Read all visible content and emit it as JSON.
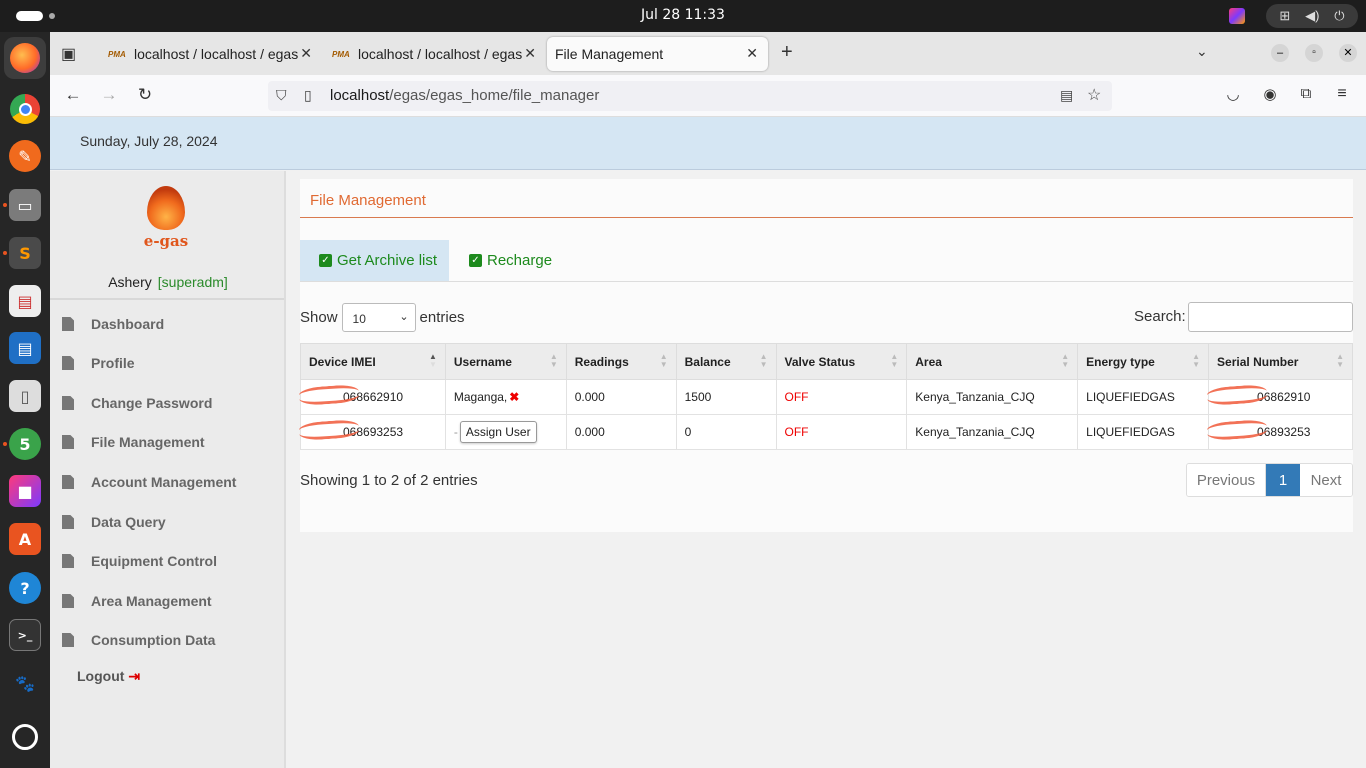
{
  "system": {
    "clock": "Jul 28  11:33",
    "tray": [
      "network-icon",
      "volume-icon",
      "power-icon"
    ]
  },
  "dock": [
    "firefox-icon",
    "chrome-icon",
    "inkscape-icon",
    "files-icon",
    "sublime-icon",
    "document-viewer-icon",
    "libreoffice-writer-icon",
    "text-editor-icon",
    "calculator-icon",
    "jetbrains-icon",
    "app-center-icon",
    "help-icon",
    "terminal-icon",
    "gimp-icon",
    "ubuntu-icon"
  ],
  "browser": {
    "tabs": [
      {
        "label": "localhost / localhost / egas"
      },
      {
        "label": "localhost / localhost / egas"
      },
      {
        "label": "File Management"
      }
    ],
    "url_host": "localhost",
    "url_path": "/egas/egas_home/file_manager"
  },
  "page": {
    "date": "Sunday, July 28, 2024",
    "brand": "e-gas",
    "user_name": "Ashery",
    "user_role": "[superadm]",
    "menu": [
      "Dashboard",
      "Profile",
      "Change Password",
      "File Management",
      "Account Management",
      "Data Query",
      "Equipment Control",
      "Area Management",
      "Consumption Data"
    ],
    "logout": "Logout",
    "title": "File Management",
    "tabs": [
      {
        "label": "Get Archive list"
      },
      {
        "label": "Recharge"
      }
    ],
    "show_label": "Show",
    "entries_value": "10",
    "entries_label": "entries",
    "search_label": "Search:",
    "table": {
      "headers": [
        "Device IMEI",
        "Username",
        "Readings",
        "Balance",
        "Valve Status",
        "Area",
        "Energy type",
        "Serial Number"
      ],
      "rows": [
        {
          "imei": "8618...068662910",
          "imei_visible": "068662910",
          "username": "Maganga,",
          "readings": "0.000",
          "balance": "1500",
          "valve": "OFF",
          "area": "Kenya_Tanzania_CJQ",
          "energy": "LIQUEFIEDGAS",
          "serial_visible": "06862910"
        },
        {
          "imei": "8618...068693253",
          "imei_visible": "068693253",
          "username": "-",
          "assign_label": "Assign User",
          "readings": "0.000",
          "balance": "0",
          "valve": "OFF",
          "area": "Kenya_Tanzania_CJQ",
          "energy": "LIQUEFIEDGAS",
          "serial_visible": "06893253"
        }
      ]
    },
    "info": "Showing 1 to 2 of 2 entries",
    "pager": {
      "previous": "Previous",
      "current": "1",
      "next": "Next"
    },
    "colors": {
      "accent": "#e06a33",
      "active_tab": "#d5e6f3",
      "green": "#1d8a1d",
      "off": "#e00000",
      "pager_active": "#337ab7"
    }
  }
}
